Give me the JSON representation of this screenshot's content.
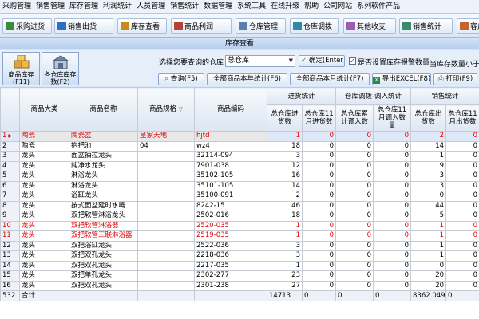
{
  "menu": [
    "采购管理",
    "销售管理",
    "库存管理",
    "利润统计",
    "人员管理",
    "销售统计",
    "数据管理",
    "系统工具",
    "在线升级",
    "帮助",
    "公司网站",
    "系列软件产品"
  ],
  "toolbar": [
    {
      "label": "采购进货",
      "icon": "cart-icon",
      "color": "#3a8a3a"
    },
    {
      "label": "销售出货",
      "icon": "sale-icon",
      "color": "#2f6fc2"
    },
    {
      "label": "库存查看",
      "icon": "stock-icon",
      "color": "#c98a1c"
    },
    {
      "label": "商品利润",
      "icon": "profit-icon",
      "color": "#b8403a"
    },
    {
      "label": "仓库管理",
      "icon": "warehouse-icon",
      "color": "#5d7fb0"
    },
    {
      "label": "仓库调拨",
      "icon": "transfer-icon",
      "color": "#2f8aa8"
    },
    {
      "label": "其他收支",
      "icon": "finance-icon",
      "color": "#9a5cb8"
    },
    {
      "label": "销售统计",
      "icon": "stats-icon",
      "color": "#3a8a6a"
    },
    {
      "label": "客户",
      "icon": "customer-icon",
      "color": "#c2662f"
    }
  ],
  "title": "库存查看",
  "panel": {
    "btn_stock": "商品库存(F11)",
    "btn_wh_stock": "各仓库库存数(F2)",
    "select_label": "选择您要查询的仓库",
    "warehouse_value": "总仓库",
    "confirm_label": "确定(Enter)",
    "alert_check_label": "是否设置库存报警数量",
    "alert_checked": true,
    "alert_hint": "当库存数量小于",
    "query_label": "查询(F5)",
    "year_stats_label": "全部商品本年统计(F6)",
    "month_stats_label": "全部商品本月统计(F7)",
    "excel_label": "导出EXCEL(F8)",
    "print_label": "打印(F9)"
  },
  "headers": {
    "category": "商品大类",
    "name": "商品名称",
    "spec": "商品规格",
    "code": "商品编码",
    "group_in": "进货统计",
    "group_transfer": "仓库调拨-调入统计",
    "group_sales": "销售统计",
    "in_total": "总仓库进货数",
    "in_month": "总仓库11月进货数",
    "tr_total": "总仓库累计调入数",
    "tr_month": "总仓库11月调入数量",
    "sales_total": "总仓库出货数",
    "sales_month": "总仓库11月出货数"
  },
  "rows": [
    {
      "n": "1",
      "cat": "陶瓷",
      "name": "陶瓷盆",
      "spec": "皇家天地",
      "code": "hjtd",
      "in": "1",
      "inm": "0",
      "tr": "0",
      "trm": "0",
      "s": "2",
      "sm": "0",
      "style": "red sel"
    },
    {
      "n": "2",
      "cat": "陶瓷",
      "name": "抱把池",
      "spec": "04",
      "code": "wz4",
      "in": "18",
      "inm": "0",
      "tr": "0",
      "trm": "0",
      "s": "14",
      "sm": "0",
      "style": ""
    },
    {
      "n": "3",
      "cat": "龙头",
      "name": "面盆抽拉龙头",
      "spec": "",
      "code": "32114-094",
      "in": "3",
      "inm": "0",
      "tr": "0",
      "trm": "0",
      "s": "1",
      "sm": "0",
      "style": ""
    },
    {
      "n": "4",
      "cat": "龙头",
      "name": "纯净水龙头",
      "spec": "",
      "code": "7901-038",
      "in": "12",
      "inm": "0",
      "tr": "0",
      "trm": "0",
      "s": "9",
      "sm": "0",
      "style": ""
    },
    {
      "n": "5",
      "cat": "龙头",
      "name": "淋浴龙头",
      "spec": "",
      "code": "35102-105",
      "in": "16",
      "inm": "0",
      "tr": "0",
      "trm": "0",
      "s": "3",
      "sm": "0",
      "style": ""
    },
    {
      "n": "6",
      "cat": "龙头",
      "name": "淋浴龙头",
      "spec": "",
      "code": "35101-105",
      "in": "14",
      "inm": "0",
      "tr": "0",
      "trm": "0",
      "s": "3",
      "sm": "0",
      "style": ""
    },
    {
      "n": "7",
      "cat": "龙头",
      "name": "浴缸龙头",
      "spec": "",
      "code": "35100-091",
      "in": "2",
      "inm": "0",
      "tr": "0",
      "trm": "0",
      "s": "0",
      "sm": "0",
      "style": ""
    },
    {
      "n": "8",
      "cat": "龙头",
      "name": "按式面盆延时水嘴",
      "spec": "",
      "code": "8242-15",
      "in": "46",
      "inm": "0",
      "tr": "0",
      "trm": "0",
      "s": "44",
      "sm": "0",
      "style": ""
    },
    {
      "n": "9",
      "cat": "龙头",
      "name": "双把软管淋浴龙头",
      "spec": "",
      "code": "2502-016",
      "in": "18",
      "inm": "0",
      "tr": "0",
      "trm": "0",
      "s": "5",
      "sm": "0",
      "style": ""
    },
    {
      "n": "10",
      "cat": "龙头",
      "name": "双把软管淋浴器",
      "spec": "",
      "code": "2520-035",
      "in": "1",
      "inm": "0",
      "tr": "0",
      "trm": "0",
      "s": "1",
      "sm": "0",
      "style": "red"
    },
    {
      "n": "11",
      "cat": "龙头",
      "name": "双把软管三联淋浴器",
      "spec": "",
      "code": "2519-035",
      "in": "1",
      "inm": "0",
      "tr": "0",
      "trm": "0",
      "s": "1",
      "sm": "0",
      "style": "red"
    },
    {
      "n": "12",
      "cat": "龙头",
      "name": "双把浴缸龙头",
      "spec": "",
      "code": "2522-036",
      "in": "3",
      "inm": "0",
      "tr": "0",
      "trm": "0",
      "s": "1",
      "sm": "0",
      "style": ""
    },
    {
      "n": "13",
      "cat": "龙头",
      "name": "双把双孔龙头",
      "spec": "",
      "code": "2218-036",
      "in": "3",
      "inm": "0",
      "tr": "0",
      "trm": "0",
      "s": "1",
      "sm": "0",
      "style": ""
    },
    {
      "n": "14",
      "cat": "龙头",
      "name": "双把双孔龙头",
      "spec": "",
      "code": "2217-035",
      "in": "1",
      "inm": "0",
      "tr": "0",
      "trm": "0",
      "s": "0",
      "sm": "0",
      "style": ""
    },
    {
      "n": "15",
      "cat": "龙头",
      "name": "双把单孔龙头",
      "spec": "",
      "code": "2302-277",
      "in": "23",
      "inm": "0",
      "tr": "0",
      "trm": "0",
      "s": "20",
      "sm": "0",
      "style": ""
    },
    {
      "n": "16",
      "cat": "龙头",
      "name": "双把双孔龙头",
      "spec": "",
      "code": "2301-238",
      "in": "27",
      "inm": "0",
      "tr": "0",
      "trm": "0",
      "s": "20",
      "sm": "0",
      "style": ""
    }
  ],
  "footer": {
    "count": "532",
    "label": "合计",
    "in": "14713",
    "inm": "0",
    "tr": "0",
    "trm": "0",
    "s": "8362.049",
    "sm": "0"
  }
}
